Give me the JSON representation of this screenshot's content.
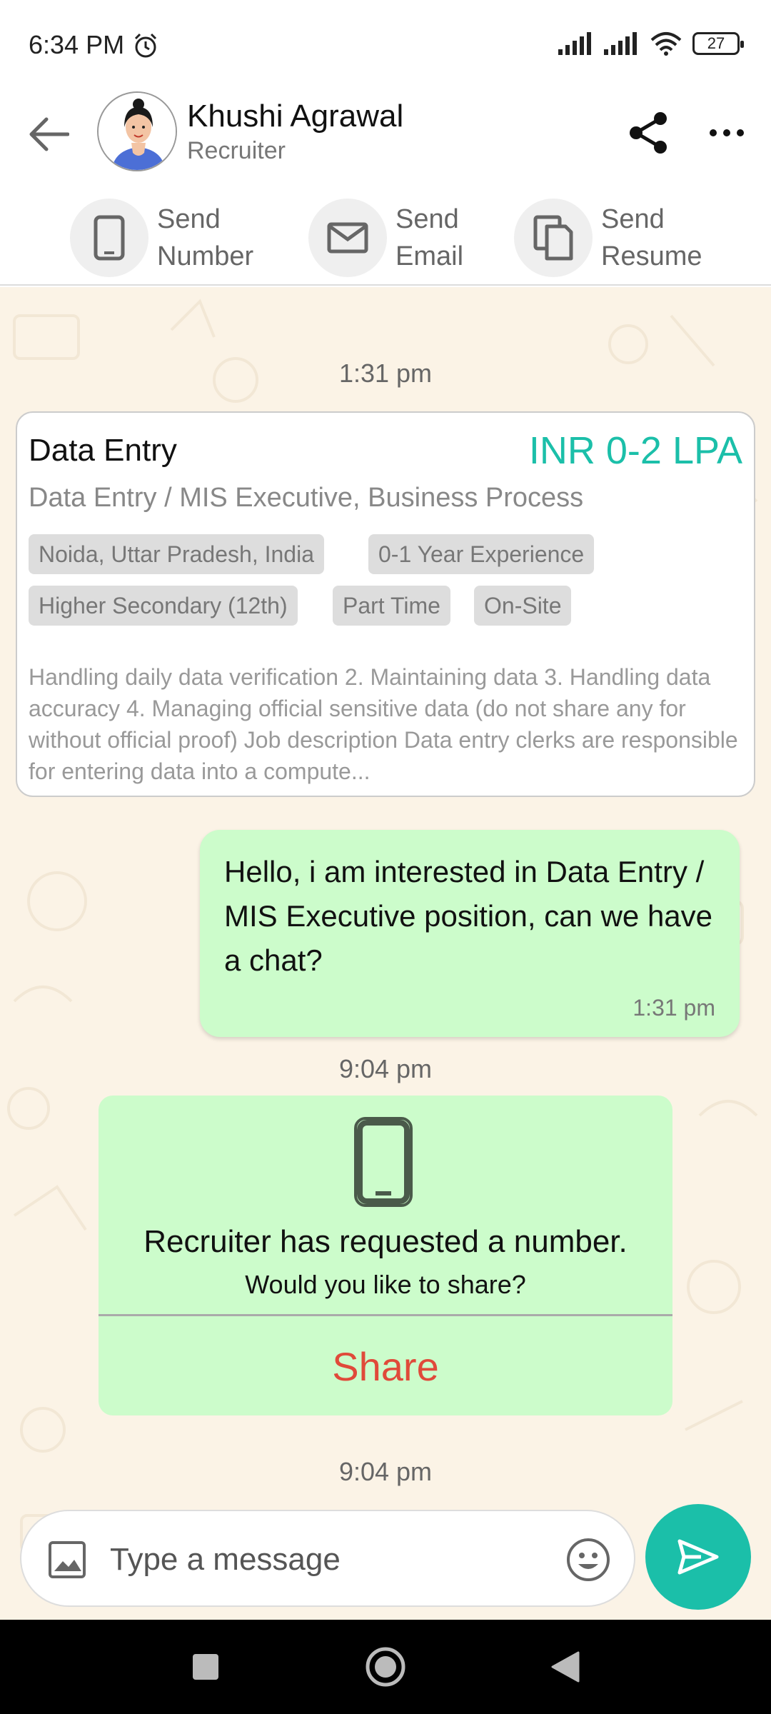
{
  "status_bar": {
    "time": "6:34 PM",
    "battery": "27"
  },
  "header": {
    "back_icon": "arrow-left-icon",
    "name": "Khushi Agrawal",
    "role": "Recruiter",
    "share_icon": "share-icon",
    "more_icon": "more-horizontal-icon"
  },
  "actions": [
    {
      "icon": "phone-icon",
      "line1": "Send",
      "line2": "Number"
    },
    {
      "icon": "mail-icon",
      "line1": "Send",
      "line2": "Email"
    },
    {
      "icon": "document-copy-icon",
      "line1": "Send",
      "line2": "Resume"
    }
  ],
  "chat": {
    "time_1": "1:31 pm",
    "job": {
      "title": "Data Entry",
      "salary": "INR 0-2 LPA",
      "subtitle": "Data Entry / MIS Executive, Business Process",
      "tags": [
        "Noida, Uttar Pradesh, India",
        "0-1 Year Experience",
        "Higher Secondary (12th)",
        "Part Time",
        "On-Site"
      ],
      "description": "Handling daily data verification 2. Maintaining data 3. Handling data accuracy 4. Managing official sensitive data (do not share any for without official proof) Job description Data entry clerks are responsible for entering data into a compute..."
    },
    "outgoing": {
      "text": "Hello, i am interested in Data Entry / MIS Executive position, can we have a chat?",
      "time": "1:31 pm"
    },
    "time_2": "9:04 pm",
    "request": {
      "title": "Recruiter has requested a number.",
      "subtitle": "Would you like to share?",
      "share_label": "Share"
    },
    "time_3": "9:04 pm"
  },
  "input": {
    "placeholder": "Type a message"
  },
  "colors": {
    "accent": "#1bbfa9",
    "bubble": "#ccfccb",
    "share_red": "#e04a3a",
    "chat_bg": "#fbf3e6"
  }
}
